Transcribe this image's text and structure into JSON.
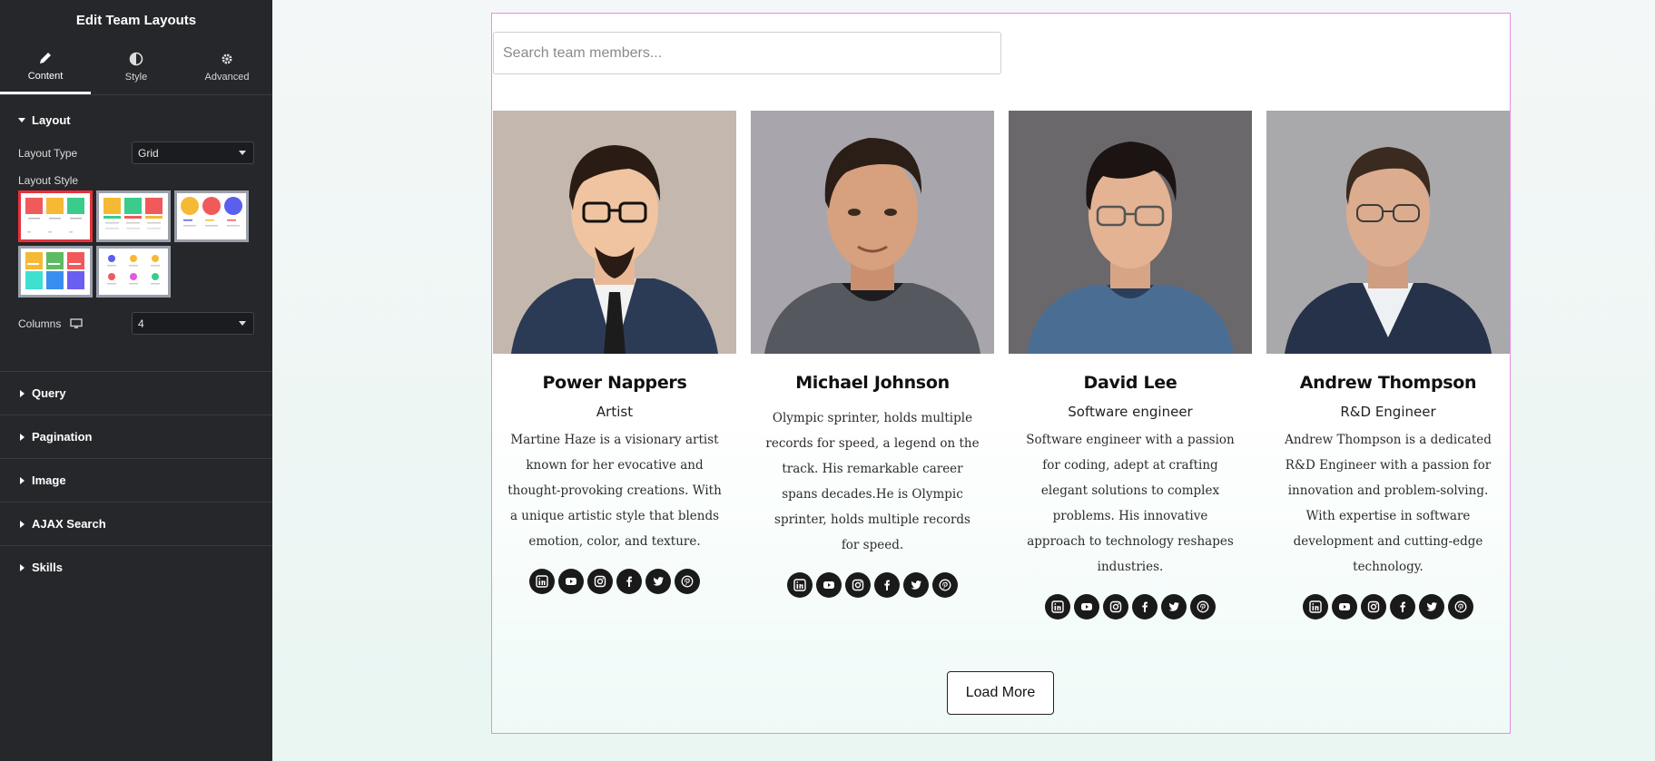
{
  "sidebar": {
    "title": "Edit Team Layouts",
    "tabs": [
      {
        "label": "Content",
        "icon": "pencil-icon"
      },
      {
        "label": "Style",
        "icon": "half-circle-icon"
      },
      {
        "label": "Advanced",
        "icon": "gear-icon"
      }
    ],
    "layout_section": {
      "title": "Layout",
      "layout_type_label": "Layout Type",
      "layout_type_value": "Grid",
      "layout_style_label": "Layout Style",
      "columns_label": "Columns",
      "columns_value": "4"
    },
    "sections": [
      "Query",
      "Pagination",
      "Image",
      "AJAX Search",
      "Skills"
    ]
  },
  "preview": {
    "search_placeholder": "Search team members...",
    "members": [
      {
        "name": "Power Nappers",
        "role": "Artist",
        "bio": "Martine Haze is a visionary artist known for her evocative and thought-provoking creations. With a unique artistic style that blends emotion, color, and texture."
      },
      {
        "name": "Michael Johnson",
        "role": "",
        "bio": "Olympic sprinter, holds multiple records for speed, a legend on the track. His remarkable career spans decades.He is Olympic sprinter, holds multiple records for speed."
      },
      {
        "name": "David Lee",
        "role": "Software engineer",
        "bio": "Software engineer with a passion for coding, adept at crafting elegant solutions to complex problems. His innovative approach to technology reshapes industries."
      },
      {
        "name": "Andrew Thompson",
        "role": "R&D Engineer",
        "bio": "Andrew Thompson is a dedicated R&D Engineer with a passion for innovation and problem-solving. With expertise in software development and cutting-edge technology."
      }
    ],
    "social_icons": [
      "linkedin-icon",
      "youtube-icon",
      "instagram-icon",
      "facebook-icon",
      "twitter-icon",
      "pinterest-icon"
    ],
    "load_more_label": "Load More"
  },
  "colors": {
    "sidebar_bg": "#26272b",
    "selected_style_border": "#e8313a",
    "widget_border": "#e58ee0"
  }
}
